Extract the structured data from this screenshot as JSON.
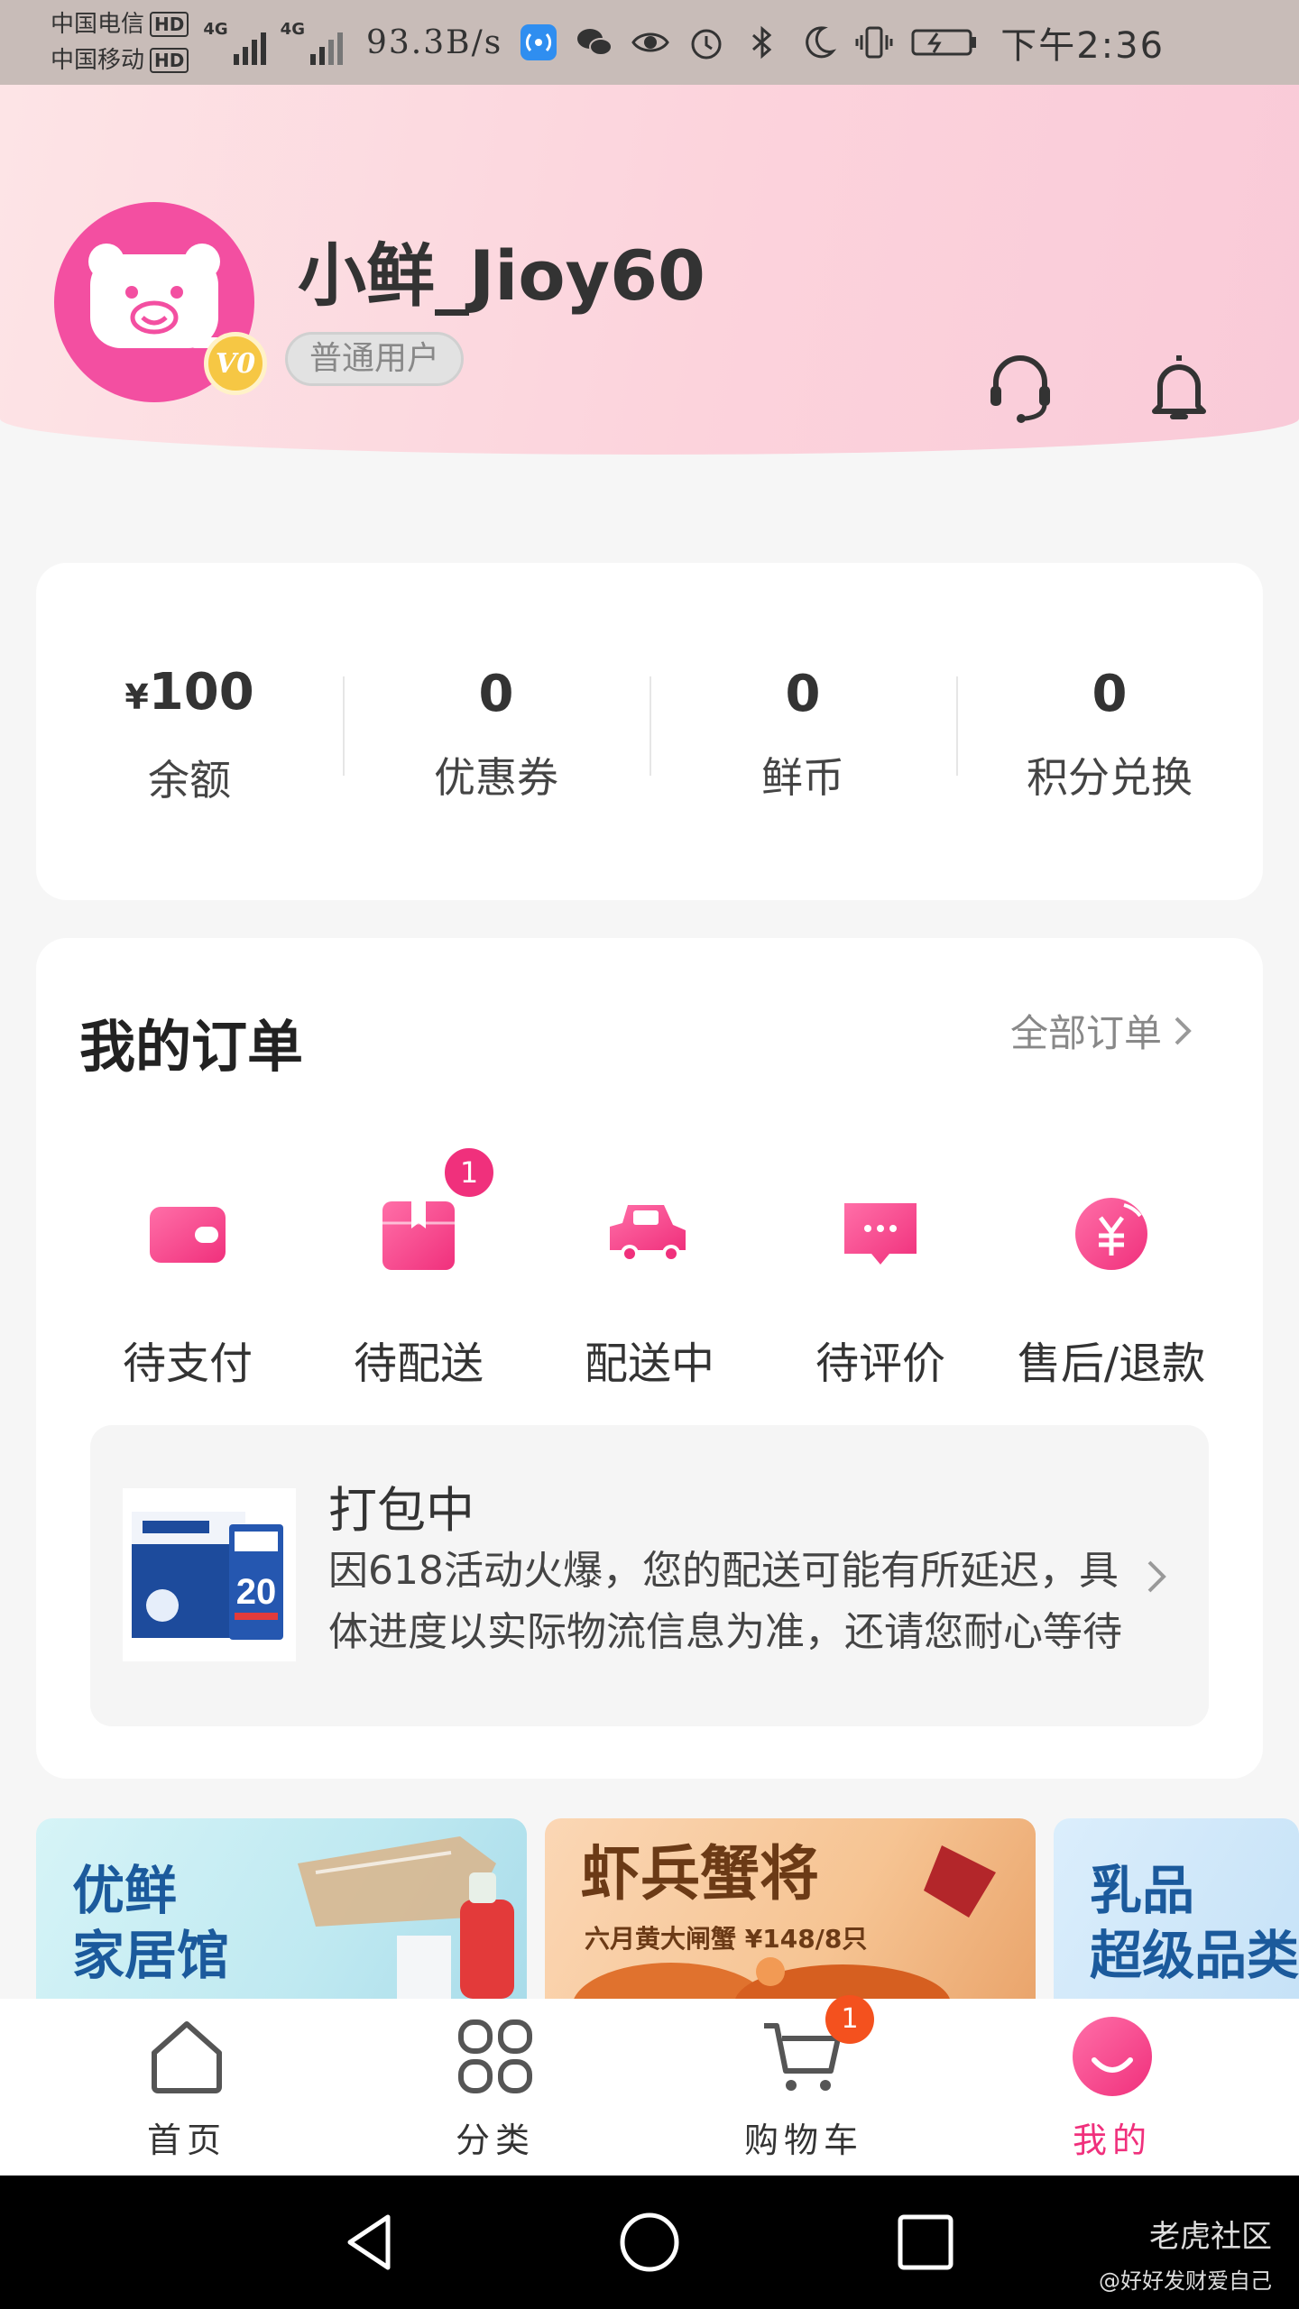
{
  "status_bar": {
    "carrier1": "中国电信",
    "carrier2": "中国移动",
    "hd": "HD",
    "network": "4G",
    "net_speed": "93.3B/s",
    "time": "下午2:36",
    "icons": [
      "wifi-hotspot-icon",
      "wechat-icon",
      "eye-icon",
      "alarm-icon",
      "bluetooth-icon",
      "moon-icon",
      "vibrate-icon",
      "battery-icon"
    ]
  },
  "profile": {
    "username": "小鲜_Jioy60",
    "level": "普通用户",
    "vip_badge": "V0"
  },
  "assets": [
    {
      "currency": "¥",
      "value": "100",
      "label": "余额"
    },
    {
      "value": "0",
      "label": "优惠券"
    },
    {
      "value": "0",
      "label": "鲜币"
    },
    {
      "value": "0",
      "label": "积分兑换"
    }
  ],
  "orders": {
    "title": "我的订单",
    "all_link": "全部订单",
    "states": [
      {
        "label": "待支付",
        "icon": "wallet-icon"
      },
      {
        "label": "待配送",
        "icon": "package-icon",
        "badge": "1"
      },
      {
        "label": "配送中",
        "icon": "delivery-truck-icon"
      },
      {
        "label": "待评价",
        "icon": "comment-icon"
      },
      {
        "label": "售后/退款",
        "icon": "refund-icon"
      }
    ],
    "shipment": {
      "title": "打包中",
      "description": "因618活动火爆，您的配送可能有所延迟，具体进度以实际物流信息为准，还请您耐心等待"
    }
  },
  "banners": [
    {
      "line1": "优鲜",
      "line2": "家居馆"
    },
    {
      "title": "虾兵蟹将",
      "subtitle": "六月黄大闸蟹 ¥148/8只"
    },
    {
      "line1": "乳品",
      "line2": "超级品类"
    }
  ],
  "tabbar": [
    {
      "label": "首页",
      "icon": "home-icon"
    },
    {
      "label": "分类",
      "icon": "category-icon"
    },
    {
      "label": "购物车",
      "icon": "cart-icon",
      "badge": "1"
    },
    {
      "label": "我的",
      "icon": "profile-icon",
      "active": true
    }
  ],
  "watermark": {
    "line1": "老虎社区",
    "line2": "@好好发财爱自己"
  },
  "colors": {
    "accent": "#f0307c",
    "header_bg": "#fcd3dc",
    "badge": "#f4511e"
  }
}
